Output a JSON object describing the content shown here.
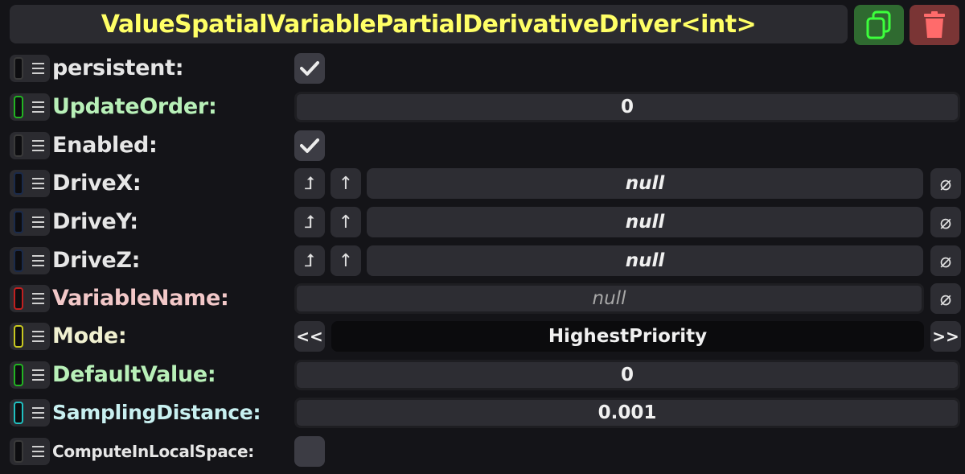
{
  "header": {
    "title": "ValueSpatialVariablePartialDerivativeDriver<int>"
  },
  "icons": {
    "duplicate": "duplicate-icon",
    "delete": "trash-icon"
  },
  "fields": [
    {
      "label": "persistent:",
      "type": "bool",
      "checked": true,
      "label_color": "#e6e6e6",
      "pill_color": "#3a3a3a"
    },
    {
      "label": "UpdateOrder:",
      "type": "number",
      "value": "0",
      "label_color": "#b8f0b8",
      "pill_color": "#22b422"
    },
    {
      "label": "Enabled:",
      "type": "bool",
      "checked": true,
      "label_color": "#e6e6e6",
      "pill_color": "#3a3a3a"
    },
    {
      "label": "DriveX:",
      "type": "ref",
      "value": "null",
      "label_color": "#e6e6e6",
      "pill_color": "#1a2a4a"
    },
    {
      "label": "DriveY:",
      "type": "ref",
      "value": "null",
      "label_color": "#e6e6e6",
      "pill_color": "#1a2a4a"
    },
    {
      "label": "DriveZ:",
      "type": "ref",
      "value": "null",
      "label_color": "#e6e6e6",
      "pill_color": "#1a2a4a"
    },
    {
      "label": "VariableName:",
      "type": "string",
      "value": "null",
      "label_color": "#f2c8c8",
      "pill_color": "#c02020"
    },
    {
      "label": "Mode:",
      "type": "enum",
      "value": "HighestPriority",
      "prev": "<<",
      "next": ">>",
      "label_color": "#f0f0d0",
      "pill_color": "#c8c820"
    },
    {
      "label": "DefaultValue:",
      "type": "number",
      "value": "0",
      "label_color": "#b8f0b8",
      "pill_color": "#22b422"
    },
    {
      "label": "SamplingDistance:",
      "type": "number",
      "value": "0.001",
      "label_color": "#c8f0f0",
      "pill_color": "#20c0c0"
    },
    {
      "label": "ComputeInLocalSpace:",
      "type": "bool",
      "checked": false,
      "label_color": "#e6e6e6",
      "pill_color": "#3a3a3a"
    }
  ],
  "ref_buttons": {
    "jump": "⮥",
    "up": "↑",
    "clear": "⌀"
  }
}
